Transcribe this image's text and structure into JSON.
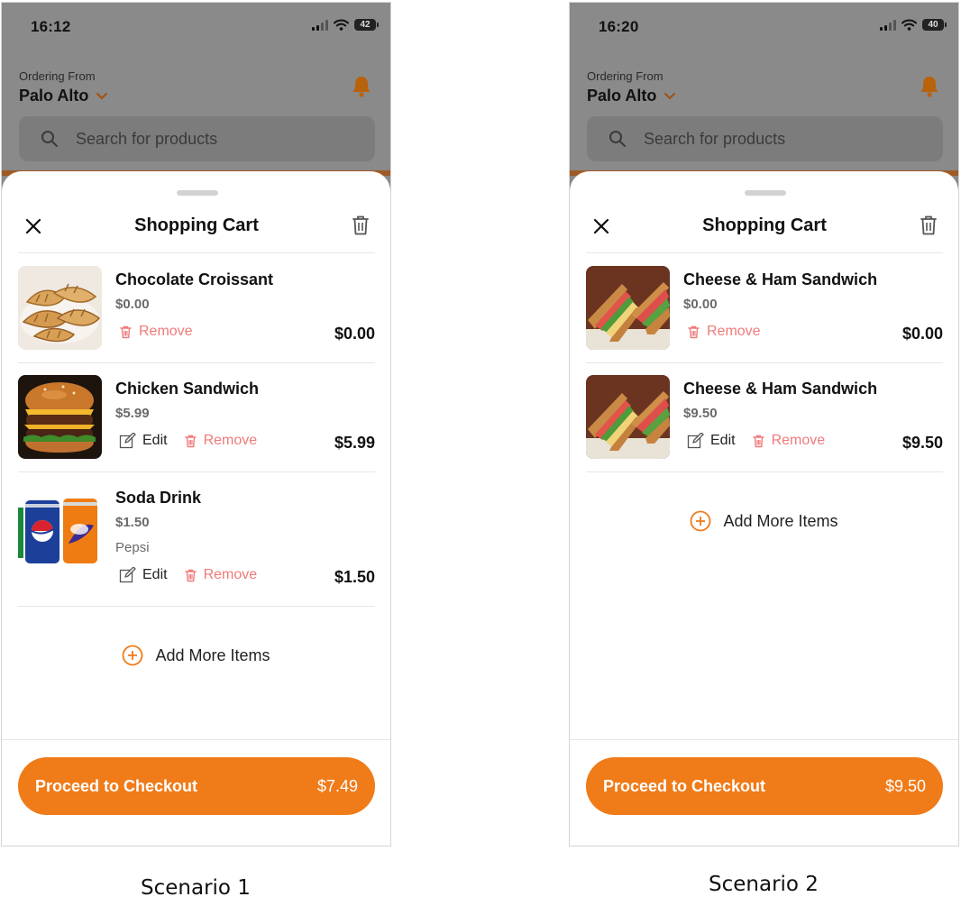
{
  "scenarios": [
    {
      "caption": "Scenario 1",
      "status": {
        "time": "16:12",
        "battery": "42"
      },
      "header": {
        "ordering_label": "Ordering From",
        "location": "Palo Alto"
      },
      "search": {
        "placeholder": "Search for products"
      },
      "cart": {
        "title": "Shopping Cart",
        "items": [
          {
            "name": "Chocolate Croissant",
            "price": "$0.00",
            "variant": "",
            "total": "$0.00",
            "edit_label": "",
            "remove_label": "Remove",
            "image_icon": "croissant-image"
          },
          {
            "name": "Chicken Sandwich",
            "price": "$5.99",
            "variant": "",
            "total": "$5.99",
            "edit_label": "Edit",
            "remove_label": "Remove",
            "image_icon": "burger-image"
          },
          {
            "name": "Soda Drink",
            "price": "$1.50",
            "variant": "Pepsi",
            "total": "$1.50",
            "edit_label": "Edit",
            "remove_label": "Remove",
            "image_icon": "soda-cans-image"
          }
        ],
        "add_more_label": "Add More Items",
        "checkout_label": "Proceed to Checkout",
        "checkout_total": "$7.49"
      }
    },
    {
      "caption": "Scenario 2",
      "status": {
        "time": "16:20",
        "battery": "40"
      },
      "header": {
        "ordering_label": "Ordering From",
        "location": "Palo Alto"
      },
      "search": {
        "placeholder": "Search for products"
      },
      "cart": {
        "title": "Shopping Cart",
        "items": [
          {
            "name": "Cheese & Ham Sandwich",
            "price": "$0.00",
            "variant": "",
            "total": "$0.00",
            "edit_label": "",
            "remove_label": "Remove",
            "image_icon": "sandwich-image"
          },
          {
            "name": "Cheese & Ham Sandwich",
            "price": "$9.50",
            "variant": "",
            "total": "$9.50",
            "edit_label": "Edit",
            "remove_label": "Remove",
            "image_icon": "sandwich-image"
          }
        ],
        "add_more_label": "Add More Items",
        "checkout_label": "Proceed to Checkout",
        "checkout_total": "$9.50"
      }
    }
  ],
  "colors": {
    "accent": "#f07b19",
    "remove": "#f07a7a",
    "bell": "#e8720c",
    "dim_overlay": "#8a8a8a"
  }
}
